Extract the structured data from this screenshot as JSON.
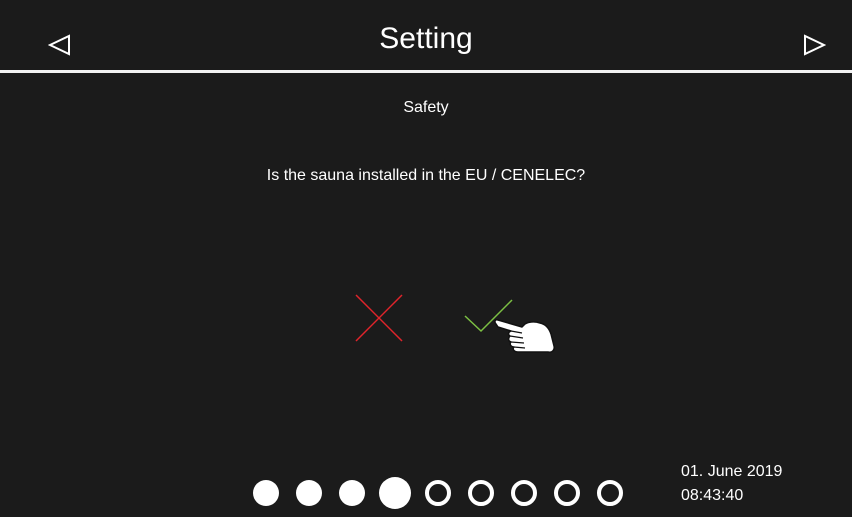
{
  "header": {
    "title": "Setting",
    "prev_icon": "triangle-left-outline-icon",
    "next_icon": "triangle-right-outline-icon"
  },
  "screen": {
    "subtitle": "Safety",
    "question": "Is the sauna installed in the EU / CENELEC?",
    "answers": [
      {
        "icon": "cross-icon",
        "color": "#e0242b"
      },
      {
        "icon": "checkmark-icon",
        "color": "#7cc043"
      }
    ]
  },
  "pager": {
    "total_pages": 9,
    "current_page": 4,
    "filled_count": 4
  },
  "status": {
    "date": "01. June 2019",
    "time": "08:43:40"
  },
  "colors": {
    "background": "#1b1b1b",
    "foreground": "#ffffff",
    "no": "#e0242b",
    "yes": "#7cc043"
  }
}
